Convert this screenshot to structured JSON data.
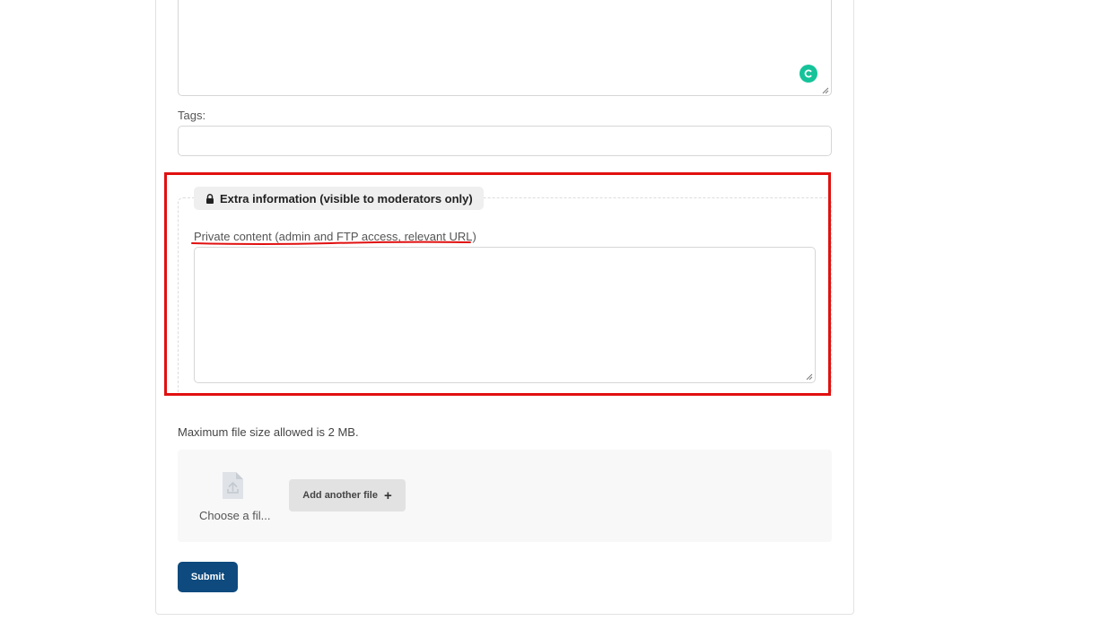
{
  "form": {
    "tags_label": "Tags:",
    "tags_value": "",
    "extra_info": {
      "legend": "Extra information (visible to moderators only)",
      "private_label": "Private content (admin and FTP access, relevant URL)",
      "private_value": ""
    },
    "max_file_size": "Maximum file size allowed is 2 MB.",
    "upload": {
      "choose_file": "Choose a fil...",
      "add_another": "Add another file",
      "add_icon": "+"
    },
    "submit_label": "Submit"
  },
  "icons": {
    "grammar": "grammarly-icon",
    "lock": "lock-icon",
    "file": "file-upload-icon",
    "plus": "plus-icon"
  },
  "colors": {
    "highlight": "#e11010",
    "submit_bg": "#0e4a7e",
    "grammar": "#15c39a"
  }
}
